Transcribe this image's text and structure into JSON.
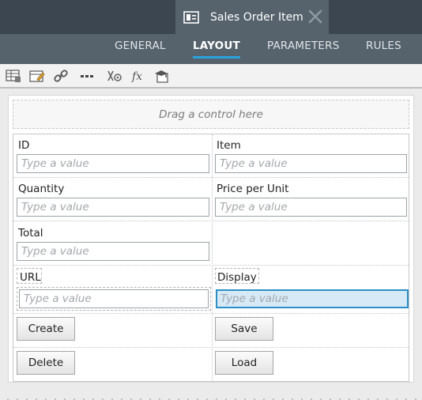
{
  "window": {
    "title": "Sales Order Item"
  },
  "tabs": [
    {
      "label": "GENERAL",
      "active": false
    },
    {
      "label": "LAYOUT",
      "active": true
    },
    {
      "label": "PARAMETERS",
      "active": false
    },
    {
      "label": "RULES",
      "active": false
    }
  ],
  "toolbar": {
    "icons": [
      "table-icon",
      "edit-table-icon",
      "link-icon",
      "more-icon",
      "settings-rules-icon",
      "expression-fx-icon",
      "publish-icon"
    ]
  },
  "canvas": {
    "drop_zone_text": "Drag a control here"
  },
  "form": {
    "id": {
      "label": "ID",
      "placeholder": "Type a value"
    },
    "item": {
      "label": "Item",
      "placeholder": "Type a value"
    },
    "quantity": {
      "label": "Quantity",
      "placeholder": "Type a value"
    },
    "price": {
      "label": "Price per Unit",
      "placeholder": "Type a value"
    },
    "total": {
      "label": "Total",
      "placeholder": "Type a value"
    },
    "url": {
      "label": "URL",
      "placeholder": "Type a value"
    },
    "display": {
      "label": "Display",
      "placeholder": "Type a value",
      "selected": true
    }
  },
  "buttons": {
    "create": "Create",
    "save": "Save",
    "delete": "Delete",
    "load": "Load"
  },
  "colors": {
    "accent": "#2aa3dc",
    "header": "#3b4650",
    "nav": "#56626c",
    "selection": "#d6e9f7"
  }
}
